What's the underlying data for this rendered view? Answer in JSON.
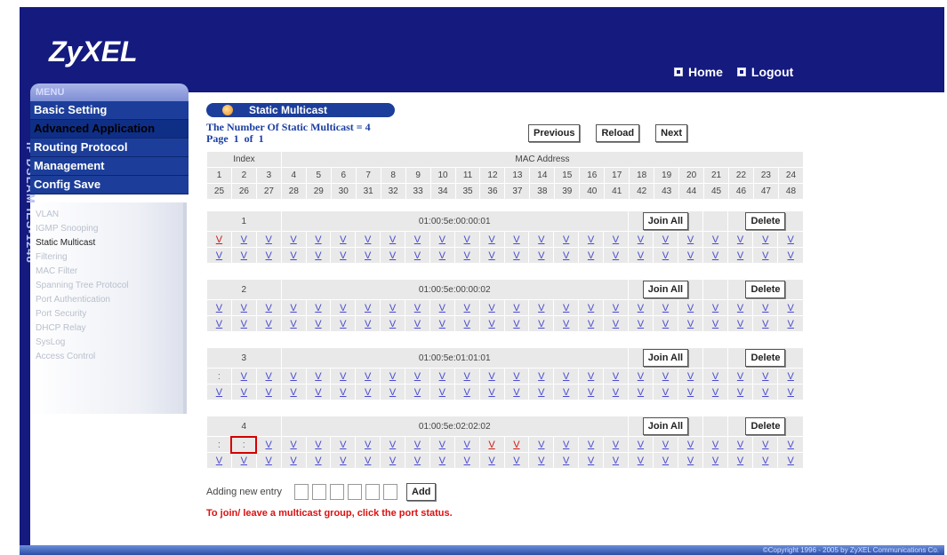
{
  "header": {
    "logo": "ZyXEL",
    "home": "Home",
    "logout": "Logout"
  },
  "sidebar": {
    "vertical_label": "IP DSLAM IES-1248",
    "menu_tab": "MENU",
    "menu": [
      "Basic Setting",
      "Advanced Application",
      "Routing Protocol",
      "Management",
      "Config Save"
    ],
    "selected_menu": "Advanced Application",
    "submenu": [
      "VLAN",
      "IGMP Snooping",
      "Static Multicast",
      "Filtering",
      "MAC Filter",
      "Spanning Tree Protocol",
      "Port Authentication",
      "Port Security",
      "DHCP Relay",
      "SysLog",
      "Access Control"
    ],
    "active_submenu": "Static Multicast"
  },
  "content": {
    "title": "Static Multicast",
    "count_text": "The Number Of Static Multicast = 4",
    "page_text": "Page  1  of  1",
    "buttons": {
      "previous": "Previous",
      "reload": "Reload",
      "next": "Next"
    },
    "table_header": {
      "index_label": "Index",
      "mac_label": "MAC Address",
      "ports_row1": [
        "1",
        "2",
        "3",
        "4",
        "5",
        "6",
        "7",
        "8",
        "9",
        "10",
        "11",
        "12",
        "13",
        "14",
        "15",
        "16",
        "17",
        "18",
        "19",
        "20",
        "21",
        "22",
        "23",
        "24"
      ],
      "ports_row2": [
        "25",
        "26",
        "27",
        "28",
        "29",
        "30",
        "31",
        "32",
        "33",
        "34",
        "35",
        "36",
        "37",
        "38",
        "39",
        "40",
        "41",
        "42",
        "43",
        "44",
        "45",
        "46",
        "47",
        "48"
      ]
    },
    "join_all_label": "Join All",
    "delete_label": "Delete",
    "entries": [
      {
        "index": "1",
        "mac": "01:00:5e:00:00:01",
        "row1": [
          "V",
          "V",
          "V",
          "V",
          "V",
          "V",
          "V",
          "V",
          "V",
          "V",
          "V",
          "V",
          "V",
          "V",
          "V",
          "V",
          "V",
          "V",
          "V",
          "V",
          "V",
          "V",
          "V",
          "V"
        ],
        "row2": [
          "V",
          "V",
          "V",
          "V",
          "V",
          "V",
          "V",
          "V",
          "V",
          "V",
          "V",
          "V",
          "V",
          "V",
          "V",
          "V",
          "V",
          "V",
          "V",
          "V",
          "V",
          "V",
          "V",
          "V"
        ],
        "red1": [
          0
        ],
        "red2": []
      },
      {
        "index": "2",
        "mac": "01:00:5e:00:00:02",
        "row1": [
          "V",
          "V",
          "V",
          "V",
          "V",
          "V",
          "V",
          "V",
          "V",
          "V",
          "V",
          "V",
          "V",
          "V",
          "V",
          "V",
          "V",
          "V",
          "V",
          "V",
          "V",
          "V",
          "V",
          "V"
        ],
        "row2": [
          "V",
          "V",
          "V",
          "V",
          "V",
          "V",
          "V",
          "V",
          "V",
          "V",
          "V",
          "V",
          "V",
          "V",
          "V",
          "V",
          "V",
          "V",
          "V",
          "V",
          "V",
          "V",
          "V",
          "V"
        ],
        "red1": [],
        "red2": []
      },
      {
        "index": "3",
        "mac": "01:00:5e:01:01:01",
        "row1": [
          ":",
          "V",
          "V",
          "V",
          "V",
          "V",
          "V",
          "V",
          "V",
          "V",
          "V",
          "V",
          "V",
          "V",
          "V",
          "V",
          "V",
          "V",
          "V",
          "V",
          "V",
          "V",
          "V",
          "V"
        ],
        "row2": [
          "V",
          "V",
          "V",
          "V",
          "V",
          "V",
          "V",
          "V",
          "V",
          "V",
          "V",
          "V",
          "V",
          "V",
          "V",
          "V",
          "V",
          "V",
          "V",
          "V",
          "V",
          "V",
          "V",
          "V"
        ],
        "red1": [],
        "red2": []
      },
      {
        "index": "4",
        "mac": "01:00:5e:02:02:02",
        "row1": [
          ":",
          ":",
          "V",
          "V",
          "V",
          "V",
          "V",
          "V",
          "V",
          "V",
          "V",
          "V",
          "V",
          "V",
          "V",
          "V",
          "V",
          "V",
          "V",
          "V",
          "V",
          "V",
          "V",
          "V"
        ],
        "row2": [
          "V",
          "V",
          "V",
          "V",
          "V",
          "V",
          "V",
          "V",
          "V",
          "V",
          "V",
          "V",
          "V",
          "V",
          "V",
          "V",
          "V",
          "V",
          "V",
          "V",
          "V",
          "V",
          "V",
          "V"
        ],
        "red1": [
          11,
          12
        ],
        "red2": [],
        "highlight1": [
          1
        ]
      }
    ],
    "adding_label": "Adding new entry",
    "add_button": "Add",
    "hint": "To join/ leave a multicast group,  click the port status."
  },
  "footer": {
    "copyright": "©Copyright 1996 - 2005 by ZyXEL Communications Co."
  }
}
